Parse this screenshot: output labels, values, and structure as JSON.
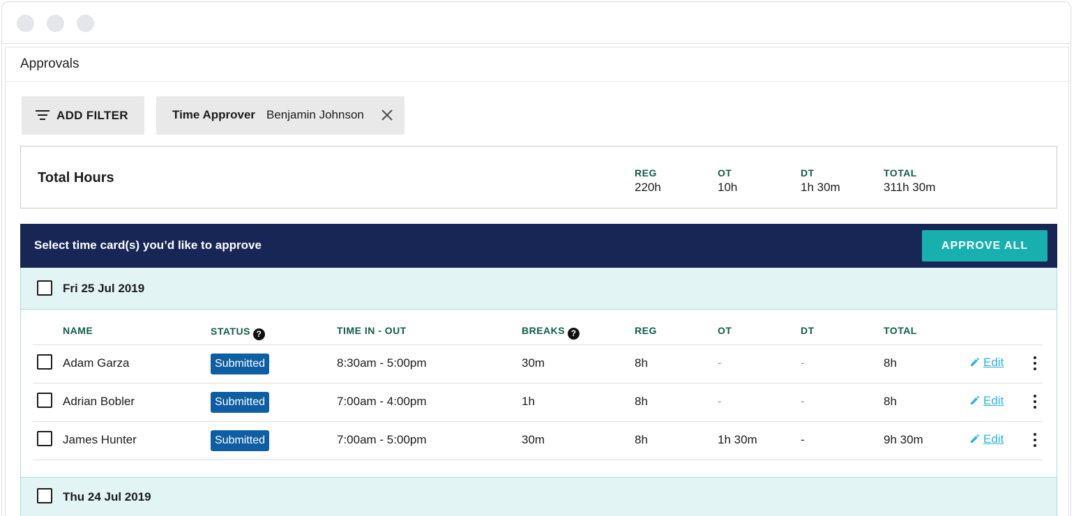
{
  "page": {
    "title": "Approvals"
  },
  "filters": {
    "add_filter_label": "ADD FILTER",
    "chip": {
      "key": "Time Approver",
      "value": "Benjamin Johnson"
    }
  },
  "totals": {
    "title": "Total Hours",
    "columns": [
      {
        "label": "REG",
        "value": "220h"
      },
      {
        "label": "OT",
        "value": "10h"
      },
      {
        "label": "DT",
        "value": "1h 30m"
      },
      {
        "label": "TOTAL",
        "value": "311h 30m"
      }
    ]
  },
  "banner": {
    "text": "Select time card(s) you’d like to approve",
    "approve_all_label": "APPROVE ALL"
  },
  "table": {
    "headers": {
      "name": "NAME",
      "status": "STATUS",
      "time": "TIME IN - OUT",
      "breaks": "BREAKS",
      "reg": "REG",
      "ot": "OT",
      "dt": "DT",
      "total": "TOTAL"
    },
    "help_glyph": "?",
    "edit_label": "Edit"
  },
  "groups": [
    {
      "date": "Fri 25 Jul 2019",
      "rows": [
        {
          "name": "Adam Garza",
          "status": "Submitted",
          "time": "8:30am - 5:00pm",
          "breaks": "30m",
          "reg": "8h",
          "ot": "-",
          "dt": "-",
          "total": "8h"
        },
        {
          "name": "Adrian Bobler",
          "status": "Submitted",
          "time": "7:00am - 4:00pm",
          "breaks": "1h",
          "reg": "8h",
          "ot": "-",
          "dt": "-",
          "total": "8h"
        },
        {
          "name": "James Hunter",
          "status": "Submitted",
          "time": "7:00am - 5:00pm",
          "breaks": "30m",
          "reg": "8h",
          "ot": "1h 30m",
          "dt": "-",
          "total": "9h 30m"
        }
      ]
    },
    {
      "date": "Thu 24 Jul 2019"
    }
  ],
  "colors": {
    "banner_bg": "#172654",
    "approve_bg": "#17b0ae",
    "header_text": "#0f5c4a",
    "badge_bg": "#0d5ea3",
    "group_bg": "#e3f4f4",
    "link": "#2bb3e2"
  },
  "icons": [
    "filter-icon",
    "close-icon",
    "help-icon",
    "pencil-icon",
    "more-vertical-icon"
  ]
}
